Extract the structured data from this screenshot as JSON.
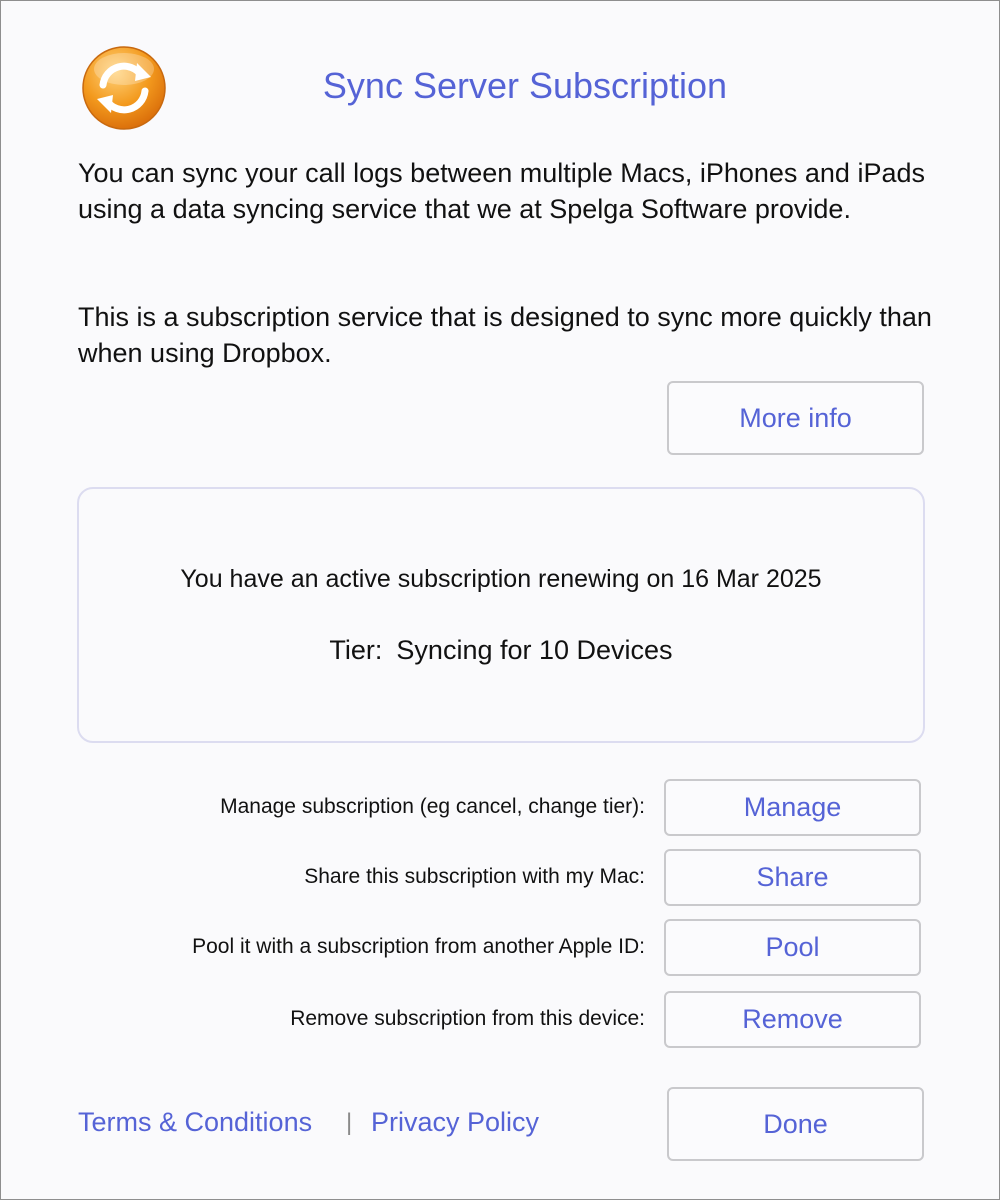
{
  "header": {
    "title": "Sync Server Subscription",
    "icon": "sync-arrows-icon",
    "icon_colors": {
      "outer": "#f39a1e",
      "inner": "#ffffff"
    }
  },
  "intro": {
    "paragraph1": "You can sync your call logs between multiple Macs, iPhones and iPads using a data syncing service that we at Spelga Software provide.",
    "paragraph2": "This is a subscription service that is designed to sync more quickly than when using Dropbox."
  },
  "more_info_label": "More info",
  "status": {
    "renewal_text": "You have an active subscription renewing on 16 Mar 2025",
    "tier_label": "Tier:",
    "tier_value": "Syncing for 10 Devices"
  },
  "actions": [
    {
      "label": "Manage subscription (eg cancel, change tier):",
      "button": "Manage"
    },
    {
      "label": "Share this subscription with my Mac:",
      "button": "Share"
    },
    {
      "label": "Pool it with a subscription from another Apple ID:",
      "button": "Pool"
    },
    {
      "label": "Remove subscription from this device:",
      "button": "Remove"
    }
  ],
  "footer": {
    "terms_label": "Terms & Conditions",
    "separator": "|",
    "privacy_label": "Privacy Policy",
    "done_label": "Done"
  },
  "colors": {
    "accent": "#5563d6",
    "text": "#111111",
    "border": "#c9c9cc"
  }
}
